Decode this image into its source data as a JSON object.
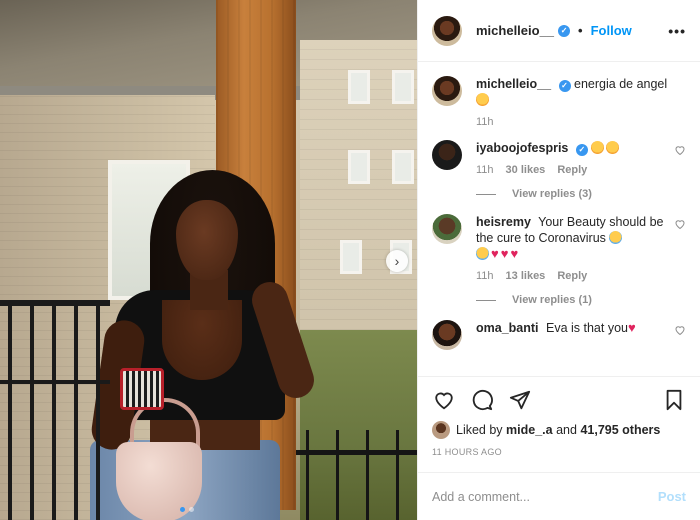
{
  "header": {
    "username": "michelleio__",
    "separator": "•",
    "follow_label": "Follow",
    "more_label": "•••"
  },
  "caption": {
    "username": "michelleio__",
    "text": "energia de angel",
    "emoji": "star-struck-emoji",
    "time": "11h"
  },
  "comments": [
    {
      "username": "iyaboojofespris",
      "time": "11h",
      "likes": "30 likes",
      "reply_label": "Reply",
      "view_replies": "View replies (3)"
    },
    {
      "username": "heisremy",
      "text_line1": "Your Beauty should",
      "text_line2": "be the cure to Coronavirus",
      "time": "11h",
      "likes": "13 likes",
      "reply_label": "Reply",
      "view_replies": "View replies (1)"
    },
    {
      "username": "oma_banti",
      "text": "Eva is that you"
    }
  ],
  "liked_by": {
    "prefix": "Liked by",
    "user": "mide_.a",
    "joiner": "and",
    "others": "41,795 others"
  },
  "timestamp": "11 HOURS AGO",
  "add_comment": {
    "placeholder": "Add a comment...",
    "post_label": "Post"
  },
  "colors": {
    "link_blue": "#0095f6",
    "verified_blue": "#3897f0",
    "post_disabled": "#b2dffc",
    "heart_red": "#e0245e"
  }
}
